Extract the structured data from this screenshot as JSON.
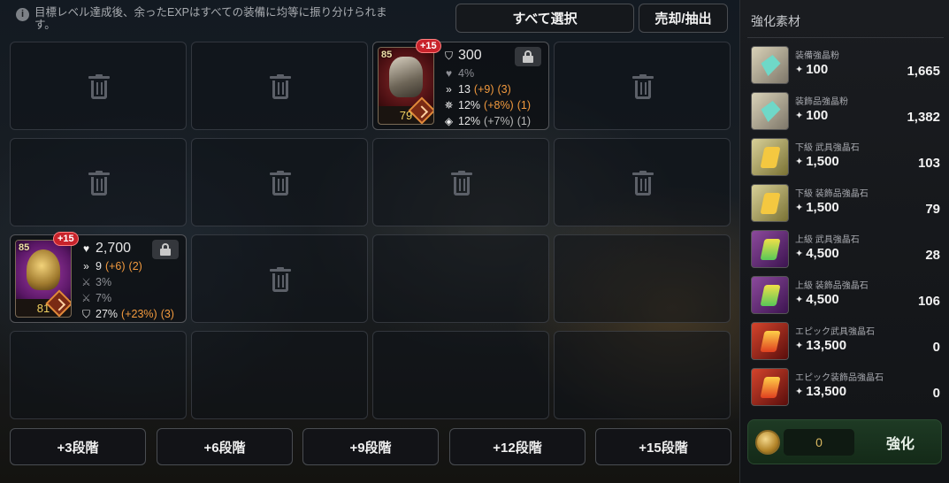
{
  "info": {
    "icon": "info-icon",
    "text": "目標レベル達成後、余ったEXPはすべての装備に均等に振り分けられます。"
  },
  "top_buttons": {
    "select_all": "すべて選択",
    "sell_extract": "売却/抽出"
  },
  "items": [
    {
      "level": "85",
      "plus": "+15",
      "number": "79",
      "icon": "armor-icon",
      "locked": false,
      "stats": [
        {
          "icon": "shield-icon",
          "value": "300",
          "bonus": "",
          "level": ""
        },
        {
          "icon": "heart-icon",
          "value": "4%",
          "bonus": "",
          "level": ""
        },
        {
          "icon": "chevron-icon",
          "value": "13",
          "bonus": "(+9)",
          "level": "(3)"
        },
        {
          "icon": "crit-icon",
          "value": "12%",
          "bonus": "(+8%)",
          "level": "(1)"
        },
        {
          "icon": "block-icon",
          "value": "12%",
          "bonus": "(+7%)",
          "level": "(1)"
        }
      ]
    },
    {
      "level": "85",
      "plus": "+15",
      "number": "81",
      "icon": "helmet-icon",
      "locked": false,
      "stats": [
        {
          "icon": "heart-icon",
          "value": "2,700",
          "bonus": "",
          "level": ""
        },
        {
          "icon": "chevron-icon",
          "value": "9",
          "bonus": "(+6)",
          "level": "(2)"
        },
        {
          "icon": "sword-icon",
          "value": "3%",
          "bonus": "",
          "level": ""
        },
        {
          "icon": "sword-icon",
          "value": "7%",
          "bonus": "",
          "level": ""
        },
        {
          "icon": "shield-icon",
          "value": "27%",
          "bonus": "(+23%)",
          "level": "(3)"
        }
      ]
    }
  ],
  "stage_buttons": [
    "+3段階",
    "+6段階",
    "+9段階",
    "+12段階",
    "+15段階"
  ],
  "panel": {
    "title": "強化素材",
    "materials": [
      {
        "name": "装備強晶粉",
        "exp": "100",
        "count": "1,665",
        "color": "silver"
      },
      {
        "name": "装飾品強晶粉",
        "exp": "100",
        "count": "1,382",
        "color": "silver"
      },
      {
        "name": "下級 武具強晶石",
        "exp": "1,500",
        "count": "103",
        "color": "green"
      },
      {
        "name": "下級 装飾品強晶石",
        "exp": "1,500",
        "count": "79",
        "color": "green"
      },
      {
        "name": "上級 武具強晶石",
        "exp": "4,500",
        "count": "28",
        "color": "purple"
      },
      {
        "name": "上級 装飾品強晶石",
        "exp": "4,500",
        "count": "106",
        "color": "purple"
      },
      {
        "name": "エピック武具強晶石",
        "exp": "13,500",
        "count": "0",
        "color": "red"
      },
      {
        "name": "エピック装飾品強晶石",
        "exp": "13,500",
        "count": "0",
        "color": "red"
      }
    ],
    "cost": "0",
    "enhance_label": "強化"
  }
}
